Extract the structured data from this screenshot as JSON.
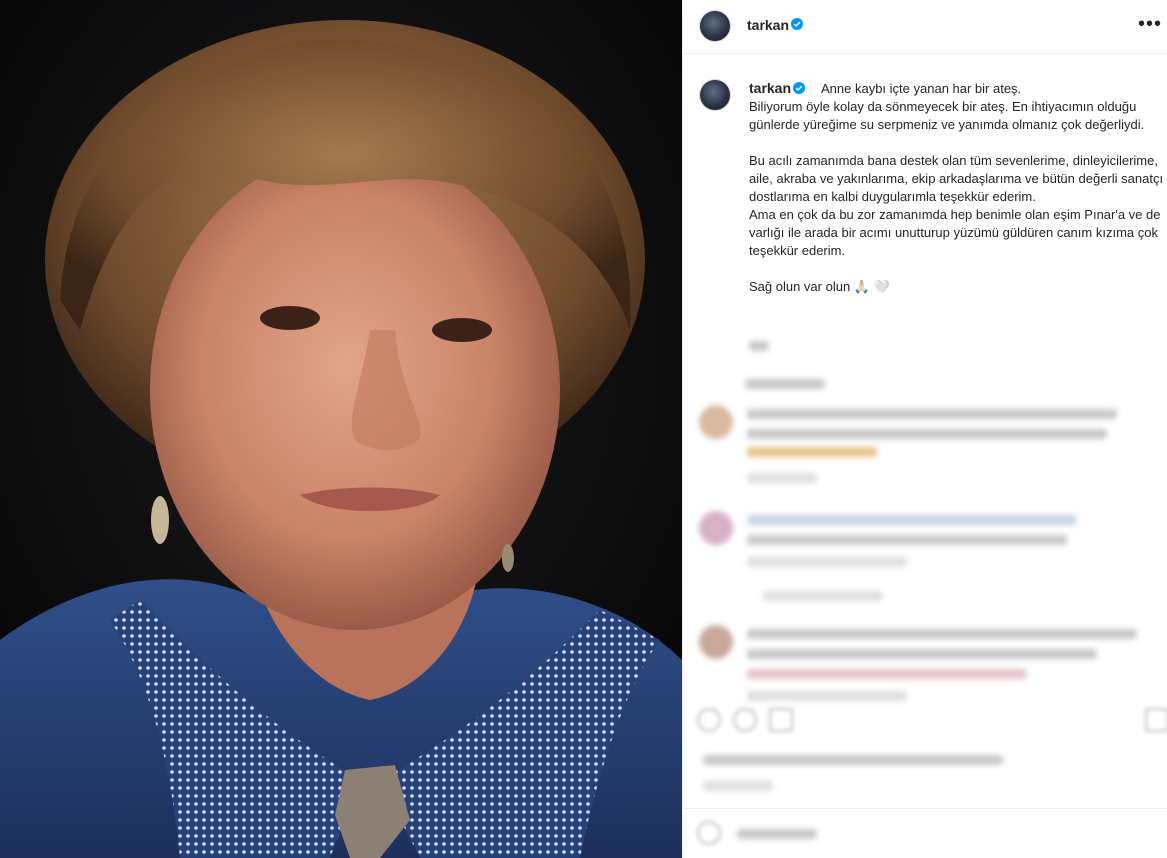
{
  "post": {
    "username": "tarkan",
    "more_glyph": "•••",
    "verified_icon": "verified-badge-icon",
    "accent_color": "#0095f6"
  },
  "caption": {
    "username": "tarkan",
    "line_1": "Anne kaybı içte yanan har bir ateş.",
    "paragraph_1": "Biliyorum öyle kolay da sönmeyecek bir ateş. En ihtiyacımın olduğu günlerde yüreğime su serpmeniz ve yanımda olmanız çok değerliydi.",
    "paragraph_2": "Bu acılı zamanımda bana destek olan tüm sevenlerime, dinleyicilerime, aile, akraba ve yakınlarıma, ekip arkadaşlarıma ve bütün değerli sanatçı dostlarıma en kalbi duygularımla teşekkür ederim.",
    "paragraph_3": "Ama en çok da bu zor zamanımda hep benimle olan eşim Pınar'a ve de varlığı ile arada bir acımı unutturup yüzümü güldüren canım kızıma çok teşekkür ederim.",
    "closing": "Sağ olun var olun 🙏🏻 🤍"
  },
  "comments_blurred": true
}
